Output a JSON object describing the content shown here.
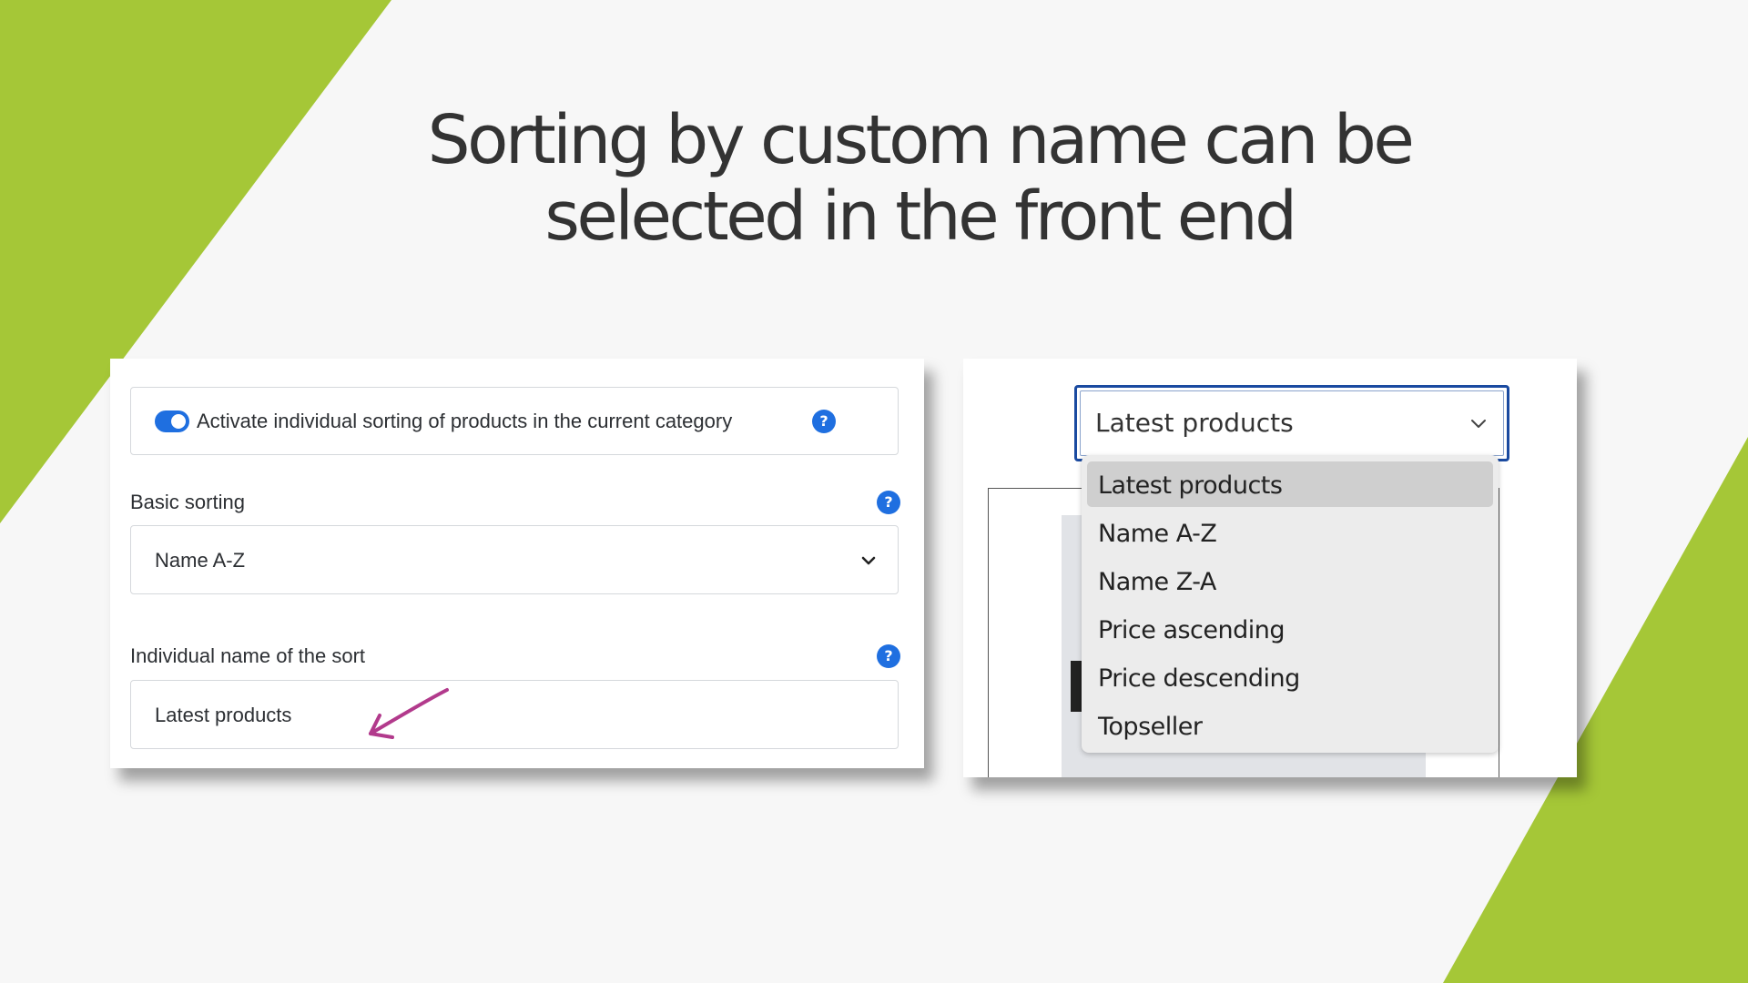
{
  "slide": {
    "title_line1": "Sorting by custom name can be",
    "title_line2": "selected in the front end",
    "accent_color": "#a5c737"
  },
  "admin_panel": {
    "toggle_label": "Activate individual sorting of products in the current category",
    "toggle_on": true,
    "help_glyph": "?",
    "basic_sorting": {
      "label": "Basic sorting",
      "value": "Name A-Z"
    },
    "custom_name": {
      "label": "Individual name of the sort",
      "value": "Latest products"
    },
    "annotation": "pink-arrow-icon"
  },
  "storefront": {
    "select_value": "Latest products",
    "options": [
      "Latest products",
      "Name A-Z",
      "Name Z-A",
      "Price ascending",
      "Price descending",
      "Topseller"
    ],
    "highlighted_option": "Latest products"
  }
}
